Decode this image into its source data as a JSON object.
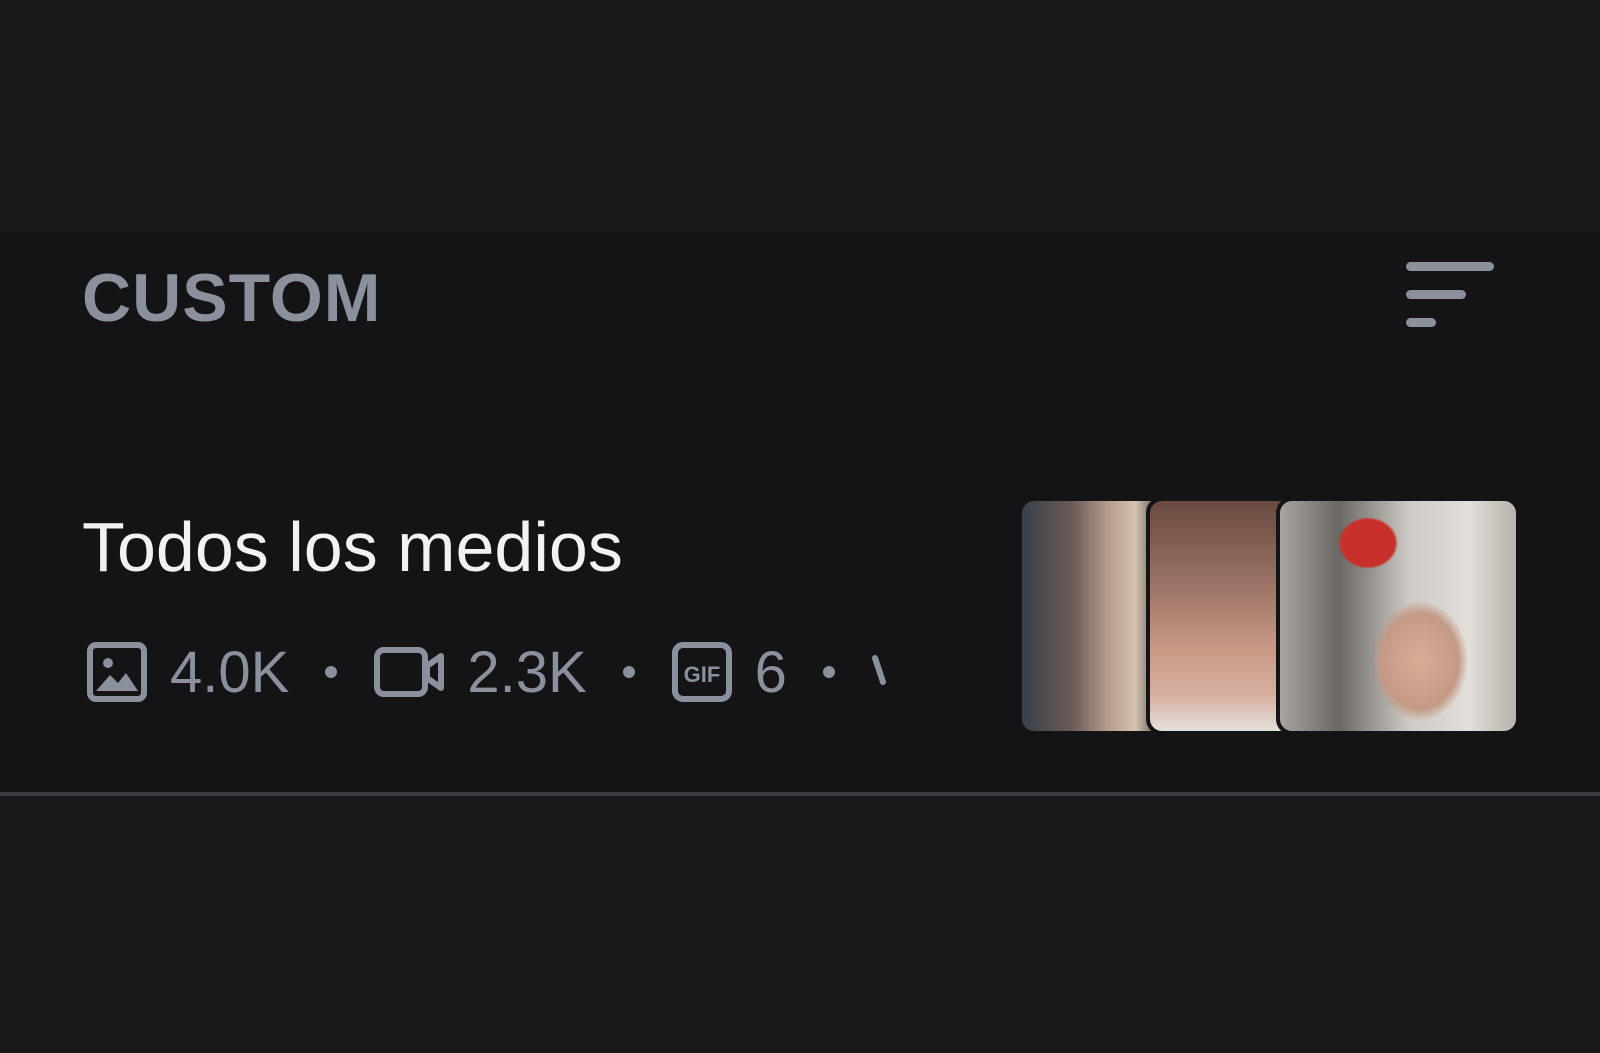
{
  "section": {
    "title": "CUSTOM",
    "sort_icon": "sort-lines-icon"
  },
  "collection": {
    "title": "Todos los medios",
    "stats": [
      {
        "icon": "image-icon",
        "value": "4.0K"
      },
      {
        "icon": "video-camera-icon",
        "value": "2.3K"
      },
      {
        "icon": "gif-icon",
        "value": "6"
      }
    ],
    "thumbnail_count": 3
  },
  "colors": {
    "background": "#19191c",
    "section_background": "#141417",
    "muted_text": "#8a909c",
    "primary_text": "#f2f2f4",
    "divider": "#3a3a42"
  }
}
